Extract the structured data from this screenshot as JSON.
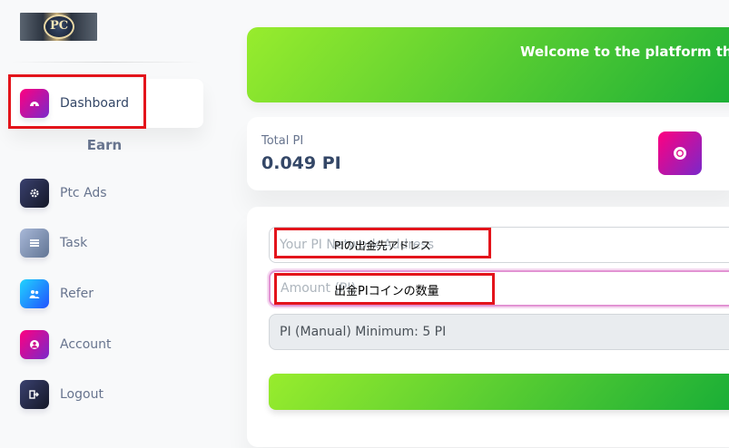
{
  "sidebar": {
    "logo_text": "PC",
    "items": [
      {
        "label": "Dashboard",
        "icon": "dashboard-icon"
      },
      {
        "label": "Ptc Ads",
        "icon": "gear-icon"
      },
      {
        "label": "Task",
        "icon": "list-icon"
      },
      {
        "label": "Refer",
        "icon": "users-icon"
      },
      {
        "label": "Account",
        "icon": "user-circle-icon"
      },
      {
        "label": "Logout",
        "icon": "logout-icon"
      }
    ],
    "section_title": "Earn"
  },
  "banner": {
    "text": "Welcome to the platform that"
  },
  "stats": {
    "label": "Total PI",
    "value": "0.049 PI",
    "icon": "coin-icon"
  },
  "form": {
    "address_placeholder": "Your PI Network Address",
    "amount_placeholder": "Amount (PI)",
    "method_value": "PI (Manual) Minimum: 5 PI",
    "submit_label": ""
  },
  "annotations": {
    "address_note": "PIの出金先アドレス",
    "amount_note": "出金PIコインの数量"
  },
  "colors": {
    "accent_green": "#98ec2d",
    "accent_pink": "#ff0080",
    "annotation_red": "#e3141b"
  }
}
